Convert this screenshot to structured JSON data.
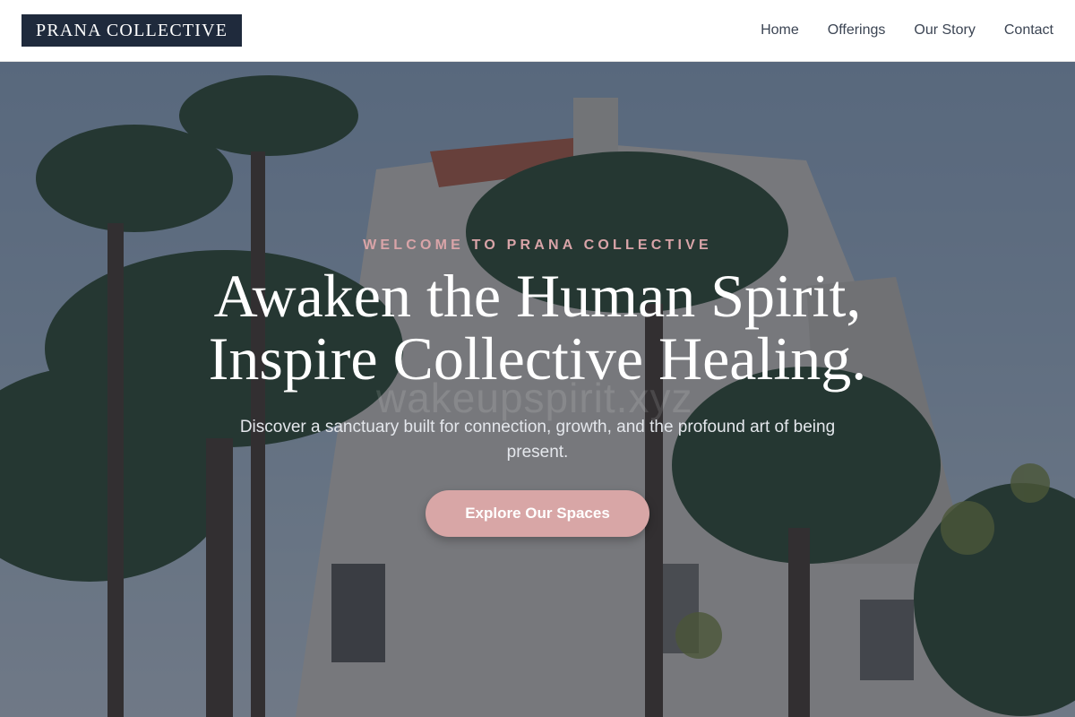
{
  "header": {
    "logo_text": "PRANA COLLECTIVE",
    "nav": [
      {
        "label": "Home"
      },
      {
        "label": "Offerings"
      },
      {
        "label": "Our Story"
      },
      {
        "label": "Contact"
      }
    ]
  },
  "hero": {
    "eyebrow": "WELCOME TO PRANA COLLECTIVE",
    "headline_line1": "Awaken the Human Spirit,",
    "headline_line2": "Inspire Collective Healing.",
    "subtext": "Discover a sanctuary built for connection, growth, and the profound art of being present.",
    "cta_label": "Explore Our Spaces",
    "background_image": "spanish-colonial-building-with-palm-trees",
    "watermark_text": "wakeupspirit.xyz"
  },
  "colors": {
    "logo_bg": "#1f2a3c",
    "accent_pink": "#d8a6a6",
    "eyebrow_pink": "#d9a4a8",
    "nav_text": "#3b4453",
    "overlay": "#1c2638"
  }
}
